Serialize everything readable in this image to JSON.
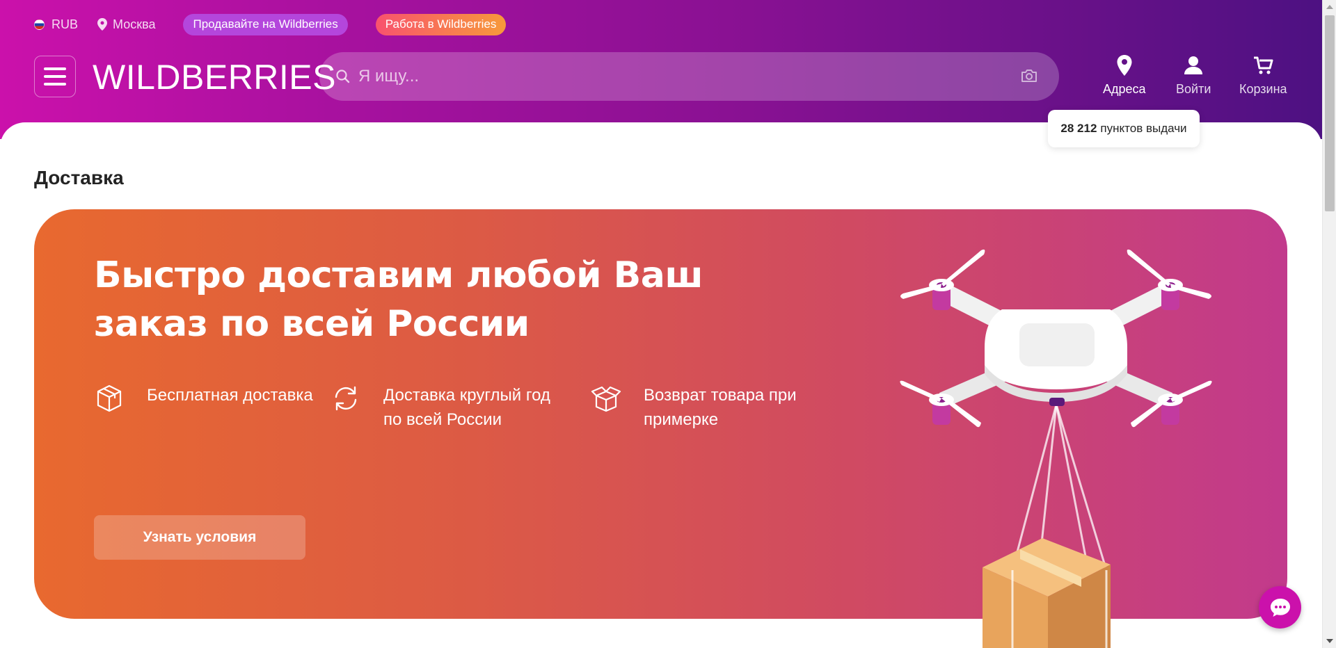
{
  "topbar": {
    "currency": "RUB",
    "city": "Москва",
    "sell_label": "Продавайте на Wildberries",
    "work_label": "Работа в Wildberries"
  },
  "header": {
    "logo": "WILDBERRIES",
    "search_placeholder": "Я ищу...",
    "nav": {
      "addresses": "Адреса",
      "login": "Войти",
      "cart": "Корзина"
    }
  },
  "tooltip": {
    "count": "28 212",
    "text": "пунктов выдачи"
  },
  "page": {
    "title": "Доставка"
  },
  "banner": {
    "heading": "Быстро доставим любой Ваш заказ по всей России",
    "features": [
      {
        "icon": "box-icon",
        "text": "Бесплатная доставка"
      },
      {
        "icon": "refresh-icon",
        "text": "Доставка круглый год по всей России"
      },
      {
        "icon": "open-box-icon",
        "text": "Возврат товара при примерке"
      }
    ],
    "cta": "Узнать условия"
  },
  "colors": {
    "brand": "#cb11ab",
    "header_end": "#4d1182",
    "banner_start": "#e8692f",
    "banner_end": "#c23a8c"
  }
}
